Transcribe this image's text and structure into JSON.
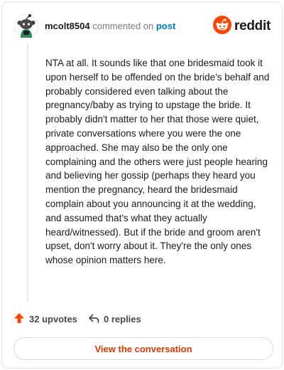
{
  "header": {
    "username": "mcolt8504",
    "action_text": "commented on",
    "post_link": "post",
    "brand_name": "reddit"
  },
  "comment": {
    "body": "NTA at all. It sounds like that one bridesmaid took it upon herself to be offended on the bride's behalf and probably considered even talking about the pregnancy/baby as trying to upstage the bride. It probably didn't matter to her that those were quiet, private conversations where you were the one approached. She may also be the only one complaining and the others were just people hearing and believing her gossip (perhaps they heard you mention the pregnancy, heard the bridesmaid complain about you announcing it at the wedding, and assumed that's what they actually heard/witnessed). But if the bride and groom aren't upset, don't worry about it. They're the only ones whose opinion matters here."
  },
  "actions": {
    "upvotes": "32 upvotes",
    "replies": "0 replies"
  },
  "footer": {
    "button_label": "View the conversation"
  },
  "colors": {
    "accent": "#FF4500",
    "link": "#0079D3",
    "button_text": "#D93A00"
  },
  "icons": {
    "avatar": "snoo-avatar",
    "brand": "reddit-logo-icon",
    "upvote": "upvote-arrow-icon",
    "reply": "reply-arrow-icon"
  }
}
